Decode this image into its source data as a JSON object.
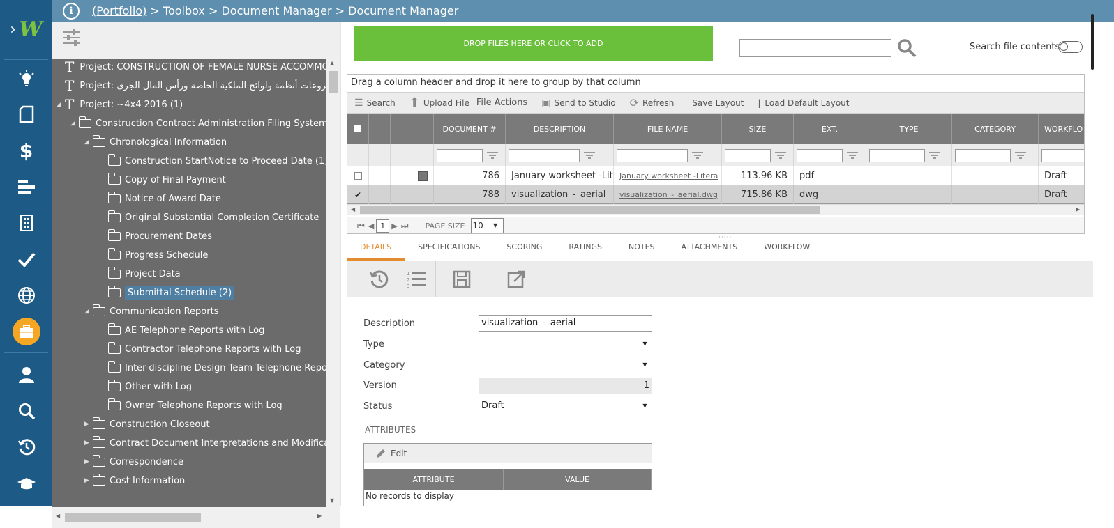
{
  "breadcrumb": {
    "root": "(Portfolio)",
    "rest": " > Toolbox > Document Manager > Document Manager"
  },
  "rail": {
    "items": [
      "lightbulb-icon",
      "document-icon",
      "dollar-icon",
      "bars-icon",
      "building-icon",
      "check-icon",
      "globe-icon",
      "briefcase-icon",
      "user-icon",
      "search-icon",
      "history-icon",
      "graduation-cap-icon"
    ],
    "dollar": "$",
    "accent": "#f5a623"
  },
  "tree": {
    "projects": [
      "Project: CONSTRUCTION OF FEMALE NURSE ACCOMMODA",
      "Project: مشروعات أنظمة ولوائح الملكية الخاصة ورأس المال الجرى",
      "Project: ~4x4 2016 (1)"
    ],
    "root_folder": "Construction Contract Administration Filing System",
    "chronological": "Chronological Information",
    "chron_children": [
      "Construction StartNotice to Proceed Date (1)",
      "Copy of Final Payment",
      "Notice of Award Date",
      "Original Substantial Completion Certificate",
      "Procurement Dates",
      "Progress Schedule",
      "Project Data",
      "Submittal Schedule (2)"
    ],
    "communication": "Communication Reports",
    "comm_children": [
      "AE Telephone Reports with Log",
      "Contractor Telephone Reports with Log",
      "Inter-discipline Design Team Telephone Reports",
      "Other with Log",
      "Owner Telephone Reports with Log"
    ],
    "collapsed": [
      "Construction Closeout",
      "Contract Document Interpretations and Modificatio",
      "Correspondence",
      "Cost Information"
    ]
  },
  "dropzone": "DROP FILES HERE OR CLICK TO ADD",
  "search": {
    "value": "",
    "contents_label": "Search file contents"
  },
  "grid": {
    "group_hint": "Drag a column header and drop it here to group by that column",
    "toolbar": {
      "search": "Search",
      "upload": "Upload File",
      "file_actions": "File Actions",
      "send": "Send to Studio",
      "refresh": "Refresh",
      "save_layout": "Save Layout",
      "separator": "|",
      "load_default": "Load Default Layout"
    },
    "columns": [
      "DOCUMENT #",
      "DESCRIPTION",
      "FILE NAME",
      "SIZE",
      "EXT.",
      "TYPE",
      "CATEGORY",
      "WORKFLO"
    ],
    "rows": [
      {
        "doc": "786",
        "desc": "January worksheet -Lite",
        "file": "January worksheet -Litera",
        "size": "113.96 KB",
        "ext": "pdf",
        "type": "",
        "category": "",
        "workflow": "Draft",
        "checked": false
      },
      {
        "doc": "788",
        "desc": "visualization_-_aerial",
        "file": "visualization_-_aerial.dwg",
        "size": "715.86 KB",
        "ext": "dwg",
        "type": "",
        "category": "",
        "workflow": "Draft",
        "checked": true
      }
    ],
    "pager": {
      "page": "1",
      "size_label": "PAGE SIZE",
      "size": "10"
    }
  },
  "tabs": [
    "DETAILS",
    "SPECIFICATIONS",
    "SCORING",
    "RATINGS",
    "NOTES",
    "ATTACHMENTS",
    "WORKFLOW"
  ],
  "form": {
    "description_label": "Description",
    "description": "visualization_-_aerial",
    "type_label": "Type",
    "type": "",
    "category_label": "Category",
    "category": "",
    "version_label": "Version",
    "version": "1",
    "status_label": "Status",
    "status": "Draft"
  },
  "attributes": {
    "title": "ATTRIBUTES",
    "edit": "Edit",
    "columns": [
      "ATTRIBUTE",
      "VALUE"
    ],
    "empty": "No records to display"
  }
}
